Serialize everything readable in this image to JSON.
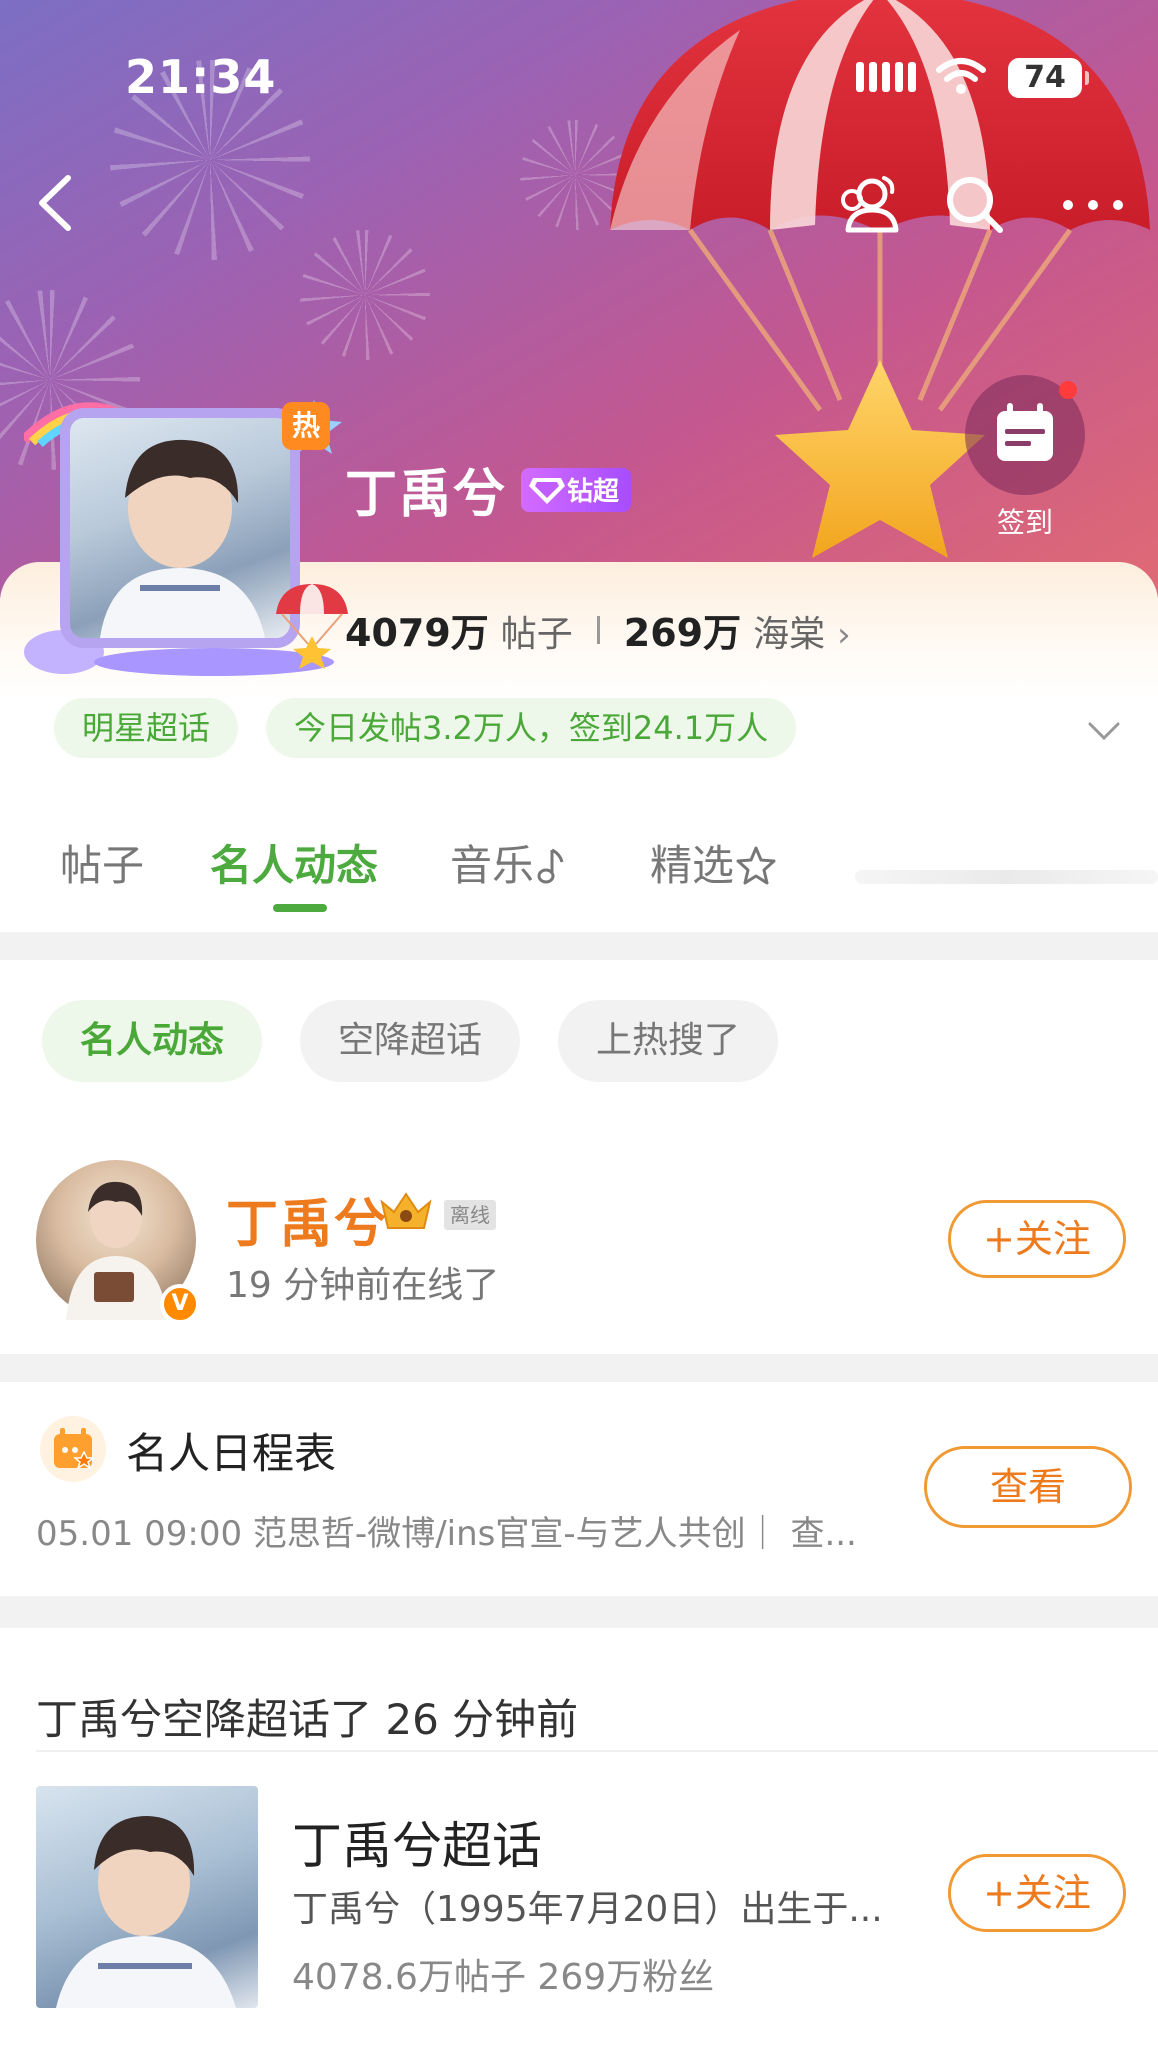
{
  "status_bar": {
    "time": "21:34",
    "battery": "74"
  },
  "header": {
    "topic_title": "丁禹兮",
    "badge_label": "钻超",
    "hot_badge": "热",
    "checkin_label": "签到",
    "stats": {
      "posts_value": "4079万",
      "posts_label": "帖子",
      "fans_value": "269万",
      "fans_label": "海棠"
    },
    "category_pill": "明星超话",
    "activity_pill": "今日发帖3.2万人，签到24.1万人"
  },
  "tabs": [
    {
      "label": "帖子",
      "active": false
    },
    {
      "label": "名人动态",
      "active": true
    },
    {
      "label": "音乐",
      "active": false
    },
    {
      "label": "精选",
      "active": false
    }
  ],
  "filters": [
    {
      "label": "名人动态",
      "active": true
    },
    {
      "label": "空降超话",
      "active": false
    },
    {
      "label": "上热搜了",
      "active": false
    }
  ],
  "celebrity": {
    "name": "丁禹兮",
    "status_tag": "离线",
    "online_text": "19 分钟前在线了",
    "verified_mark": "V",
    "follow_label": "+关注"
  },
  "schedule": {
    "title": "名人日程表",
    "detail": "05.01 09:00 范思哲-微博/ins官宣-与艺人共创｜ 查...",
    "view_label": "查看"
  },
  "feed": {
    "headline": "丁禹兮空降超话了 26 分钟前",
    "topic_name": "丁禹兮超话",
    "topic_desc": "丁禹兮（1995年7月20日）出生于...",
    "topic_stats": "4078.6万帖子  269万粉丝",
    "follow_label": "+关注"
  },
  "colors": {
    "accent_green": "#4caa3e",
    "accent_orange": "#ee7a1e"
  },
  "icons": [
    "back-icon",
    "people-icon",
    "search-icon",
    "more-icon",
    "calendar-icon",
    "diamond-icon",
    "crown-icon",
    "chevron-down-icon",
    "music-note-icon",
    "star-icon"
  ]
}
